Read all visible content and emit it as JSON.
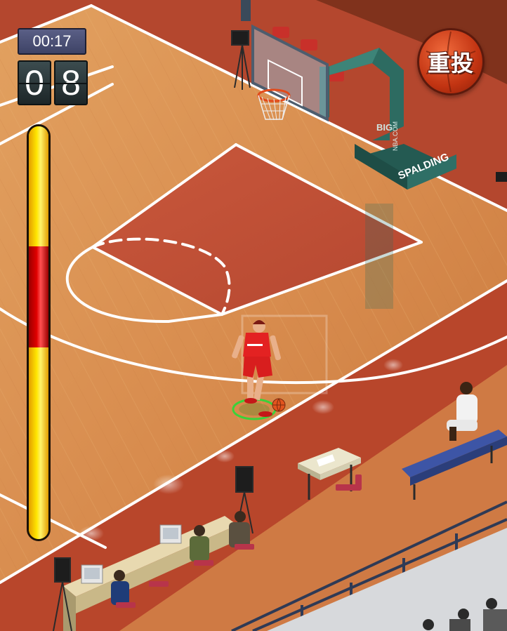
{
  "hud": {
    "timer": "00:17",
    "score_digits": [
      "0",
      "8"
    ]
  },
  "power_meter": {
    "segments": [
      {
        "name": "yellow",
        "fraction": 0.29
      },
      {
        "name": "red",
        "fraction": 0.245
      },
      {
        "name": "yellow",
        "fraction": 0.465
      }
    ]
  },
  "retry_button": {
    "label": "重投",
    "icon": "basketball-icon"
  },
  "backboard": {
    "brand": "SPALDING",
    "side_text": "NBA.COM",
    "logo": "BIG"
  },
  "colors": {
    "floor": "#d98b4d",
    "paint": "#c4533a",
    "out_of_bounds": "#b4472e",
    "court_lines": "#ffffff",
    "jersey": "#d81e1e",
    "stanchion": "#2d6b61",
    "meter_yellow": "#ffe600",
    "meter_red": "#e00000"
  }
}
